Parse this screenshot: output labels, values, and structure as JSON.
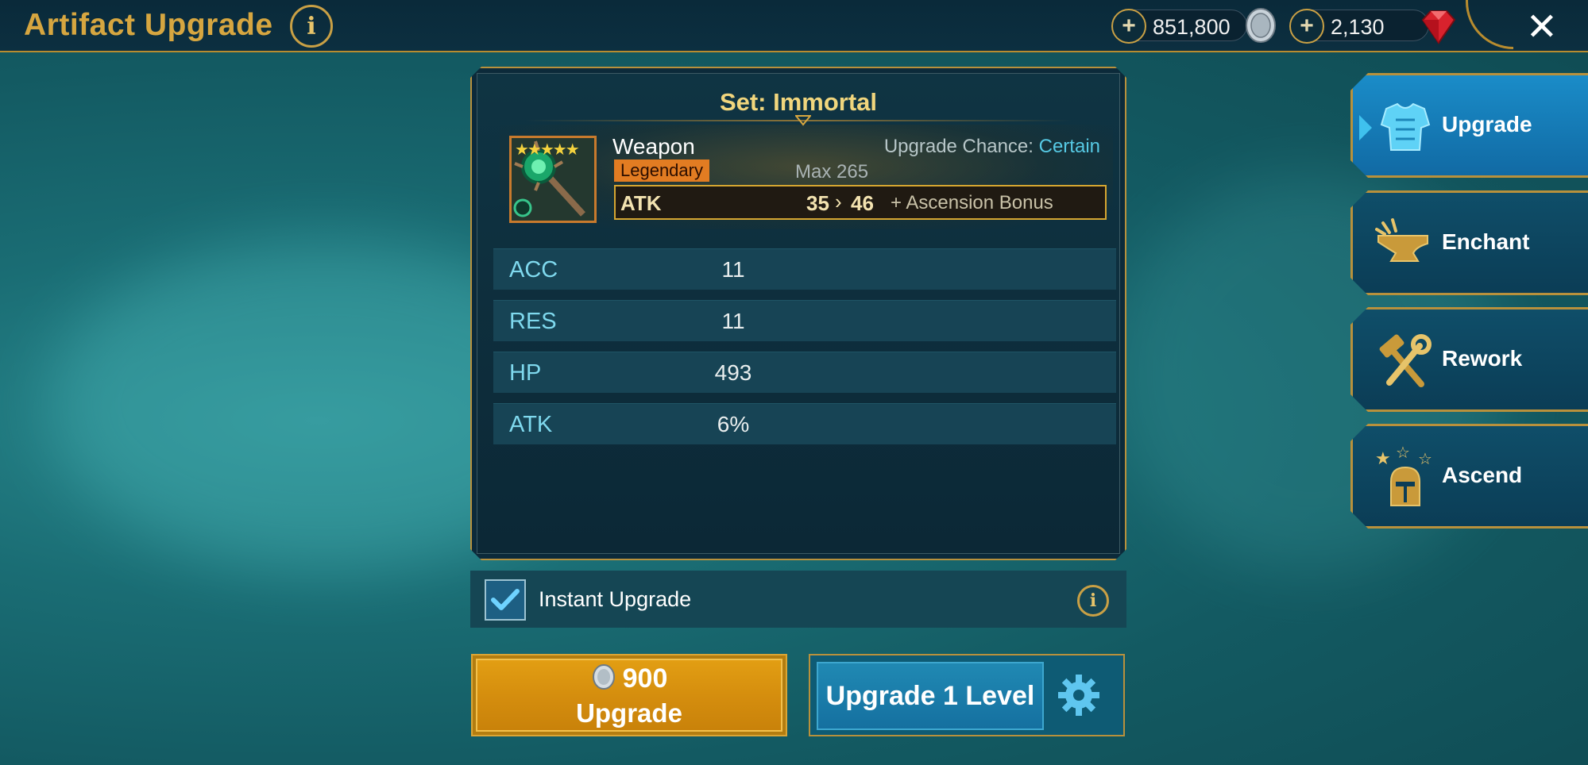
{
  "header": {
    "title": "Artifact Upgrade",
    "silver": "851,800",
    "gems": "2,130",
    "close_icon": "close-icon"
  },
  "item": {
    "set_title": "Set: Immortal",
    "type": "Weapon",
    "rarity": "Legendary",
    "rarity_color": "#e27c22",
    "stars": 5,
    "upgrade_chance_label": "Upgrade Chance:",
    "upgrade_chance_value": "Certain",
    "max_level": "Max 265",
    "main_stat": {
      "name": "ATK",
      "from": "35",
      "arrow": "›",
      "to": "46",
      "bonus": "+ Ascension Bonus"
    },
    "substats": [
      {
        "name": "ACC",
        "value": "11"
      },
      {
        "name": "RES",
        "value": "11"
      },
      {
        "name": "HP",
        "value": "493"
      },
      {
        "name": "ATK",
        "value": "6%"
      }
    ]
  },
  "instant_upgrade": {
    "label": "Instant Upgrade",
    "checked": true
  },
  "actions": {
    "upgrade_cost": "900",
    "upgrade_label": "Upgrade",
    "upgrade_level_label": "Upgrade 1 Level"
  },
  "tabs": [
    {
      "label": "Upgrade",
      "icon": "armor-icon",
      "active": true
    },
    {
      "label": "Enchant",
      "icon": "anvil-icon",
      "active": false
    },
    {
      "label": "Rework",
      "icon": "hammer-wrench-icon",
      "active": false
    },
    {
      "label": "Ascend",
      "icon": "helmet-stars-icon",
      "active": false
    }
  ],
  "colors": {
    "accent_gold": "#b8913c",
    "stat_cyan": "#7fd9ee",
    "chance_blue": "#56c9e4"
  }
}
